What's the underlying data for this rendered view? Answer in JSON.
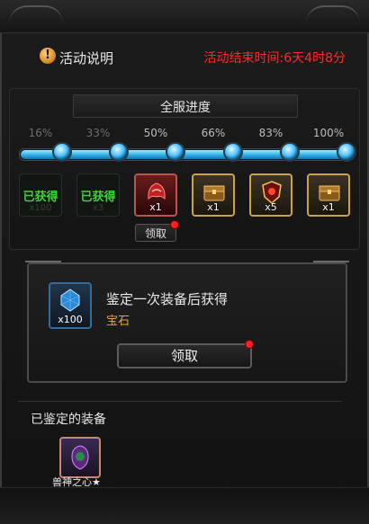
{
  "header": {
    "info_icon_glyph": "!",
    "title": "活动说明",
    "countdown": "活动结束时间:6天4时8分"
  },
  "progress": {
    "title": "全服进度",
    "current_progress_percent": 100,
    "milestones": [
      {
        "label": "16%",
        "reached": false
      },
      {
        "label": "33%",
        "reached": false
      },
      {
        "label": "50%",
        "reached": true
      },
      {
        "label": "66%",
        "reached": true
      },
      {
        "label": "83%",
        "reached": true
      },
      {
        "label": "100%",
        "reached": true
      }
    ],
    "rewards": [
      {
        "status_label": "已获得",
        "ghost_qty": "x100",
        "style": "claimed"
      },
      {
        "status_label": "已获得",
        "ghost_qty": "x3",
        "style": "claimed"
      },
      {
        "qty": "x1",
        "style": "red",
        "icon": "red-helmet-icon",
        "has_notification": true
      },
      {
        "qty": "x1",
        "style": "gold",
        "icon": "treasure-chest-icon"
      },
      {
        "qty": "x5",
        "style": "gold",
        "icon": "shield-emblem-icon"
      },
      {
        "qty": "x1",
        "style": "gold",
        "icon": "treasure-chest-icon"
      }
    ],
    "claim_label": "领取"
  },
  "task": {
    "reward_qty": "x100",
    "reward_icon": "blue-gem-icon",
    "description": "鉴定一次装备后获得",
    "reward_name": "宝石",
    "claim_label": "领取",
    "has_notification": true
  },
  "identified": {
    "title": "已鉴定的装备",
    "items": [
      {
        "name": "兽神之心★",
        "icon": "beast-heart-icon"
      }
    ]
  },
  "colors": {
    "countdown": "#ff2a2a",
    "claimed_text": "#3bd43b",
    "reward_name": "#e6a63a",
    "progress_fill": "#2aa8e0"
  }
}
